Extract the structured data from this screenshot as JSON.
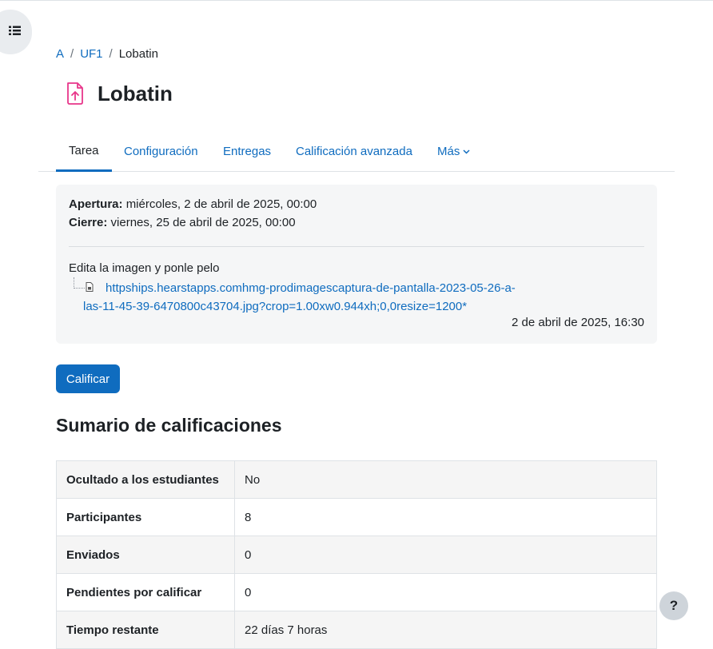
{
  "breadcrumb": [
    {
      "label": "A"
    },
    {
      "label": "UF1"
    },
    {
      "label": "Lobatin"
    }
  ],
  "page": {
    "title": "Lobatin",
    "icon": "assignment-upload-icon",
    "accent": "#e8368a"
  },
  "tabs": [
    {
      "label": "Tarea",
      "active": true
    },
    {
      "label": "Configuración"
    },
    {
      "label": "Entregas"
    },
    {
      "label": "Calificación avanzada"
    },
    {
      "label": "Más"
    }
  ],
  "dates": {
    "open_label": "Apertura:",
    "open_value": "miércoles, 2 de abril de 2025, 00:00",
    "close_label": "Cierre:",
    "close_value": "viernes, 25 de abril de 2025, 00:00"
  },
  "intro": {
    "description": "Edita la imagen y ponle pelo",
    "file_line1": "httpships.hearstapps.comhmg-prodimagescaptura-de-pantalla-2023-05-26-a-",
    "file_line2": "las-11-45-39-6470800c43704.jpg?crop=1.00xw0.944xh;0,0resize=1200*",
    "file_timestamp": "2 de abril de 2025, 16:30"
  },
  "actions": {
    "grade_label": "Calificar"
  },
  "summary": {
    "heading": "Sumario de calificaciones",
    "rows": [
      {
        "label": "Ocultado a los estudiantes",
        "value": "No"
      },
      {
        "label": "Participantes",
        "value": "8"
      },
      {
        "label": "Enviados",
        "value": "0"
      },
      {
        "label": "Pendientes por calificar",
        "value": "0"
      },
      {
        "label": "Tiempo restante",
        "value": "22 días 7 horas"
      }
    ]
  },
  "help": {
    "label": "?"
  },
  "colors": {
    "primary": "#0f6cbf",
    "box_bg": "#f5f6f7"
  }
}
